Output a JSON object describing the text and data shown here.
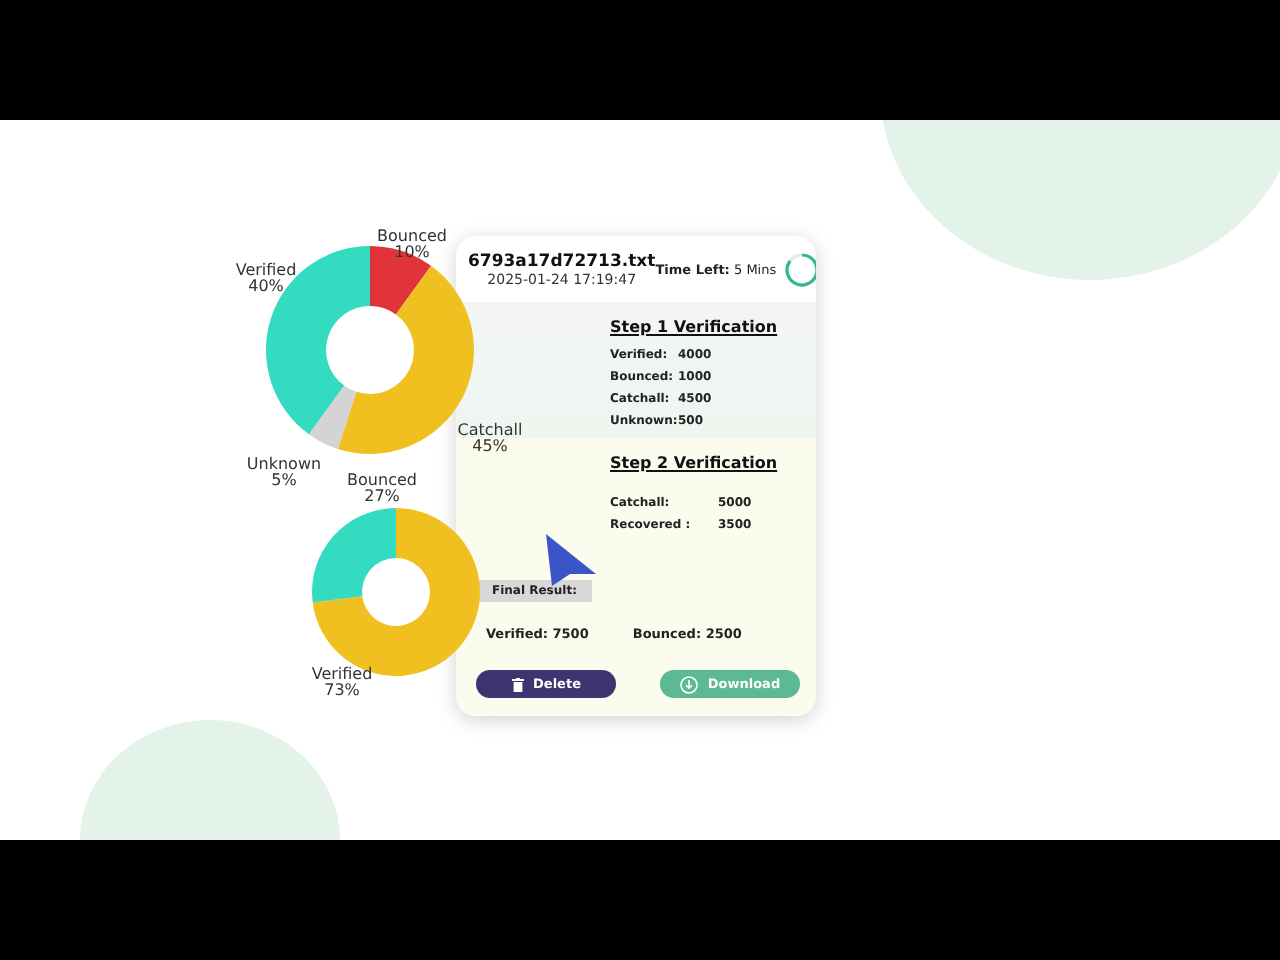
{
  "charts": [
    {
      "chart_data": {
        "type": "donut",
        "categories": [
          "Bounced",
          "Catchall",
          "Unknown",
          "Verified"
        ],
        "values": [
          10,
          45,
          5,
          40
        ],
        "colors": [
          "#e0343a",
          "#f0c020",
          "#d4d4d4",
          "#33dcc0"
        ],
        "value_labels": [
          "10%",
          "45%",
          "5%",
          "40%"
        ]
      }
    },
    {
      "chart_data": {
        "type": "donut",
        "categories": [
          "Verified",
          "Bounced"
        ],
        "values": [
          73,
          27
        ],
        "colors": [
          "#f0c020",
          "#33dcc0"
        ],
        "value_labels": [
          "73%",
          "27%"
        ]
      }
    }
  ],
  "file": {
    "name": "6793a17d72713.txt",
    "timestamp": "2025-01-24 17:19:47",
    "time_left": "**Time Left:** 5 Mins"
  },
  "step1": {
    "title": "Step 1 Verification",
    "rows": [
      {
        "label": "Verified:",
        "value": "4000"
      },
      {
        "label": "Bounced:",
        "value": "1000"
      },
      {
        "label": "Catchall:",
        "value": "4500"
      },
      {
        "label": "Unknown:",
        "value": "500"
      }
    ]
  },
  "step2": {
    "title": "Step 2 Verification",
    "rows": [
      {
        "label": "Catchall:",
        "value": "5000"
      },
      {
        "label": "Recovered :",
        "value": "3500"
      }
    ]
  },
  "final": {
    "label": "Final Result:",
    "items": [
      {
        "label": "Verified:",
        "value": "7500"
      },
      {
        "label": "Bounced:",
        "value": "2500"
      }
    ]
  },
  "buttons": [
    {
      "kind": "delete",
      "label": "Delete"
    },
    {
      "kind": "download",
      "label": "Download"
    }
  ]
}
